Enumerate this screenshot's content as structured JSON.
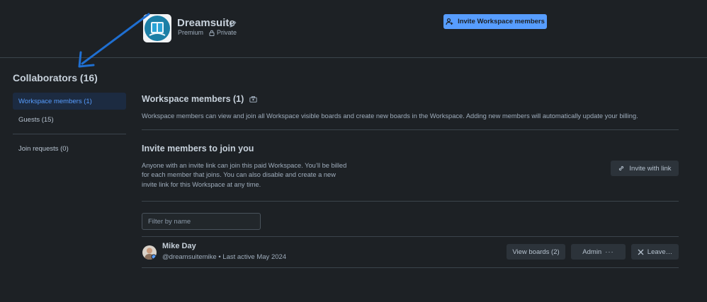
{
  "header": {
    "workspace_name": "Dreamsuite",
    "plan": "Premium",
    "visibility": "Private",
    "invite_button": "Invite Workspace members"
  },
  "sidebar": {
    "title": "Collaborators (16)",
    "items": [
      {
        "label": "Workspace members (1)",
        "active": true
      },
      {
        "label": "Guests (15)",
        "active": false
      },
      {
        "label": "Join requests (0)",
        "active": false
      }
    ]
  },
  "main": {
    "members_title": "Workspace members (1)",
    "members_desc": "Workspace members can view and join all Workspace visible boards and create new boards in the Workspace. Adding new members will automatically update your billing.",
    "invite_title": "Invite members to join you",
    "invite_desc_lines": [
      "Anyone with an invite link can join this paid Workspace. You’ll be billed",
      "for each member that joins. You can also disable and create a new",
      "invite link for this Workspace at any time."
    ],
    "invite_link_button": "Invite with link",
    "filter_placeholder": "Filter by name"
  },
  "member": {
    "name": "Mike Day",
    "meta": "@dreamsuitemike • Last active May 2024",
    "view_boards": "View boards (2)",
    "role": "Admin",
    "leave": "Leave…"
  },
  "colors": {
    "background": "#1d2125",
    "accent": "#579dff",
    "active_bg": "#1c2b41",
    "annotation_arrow": "#1f6fd1"
  }
}
